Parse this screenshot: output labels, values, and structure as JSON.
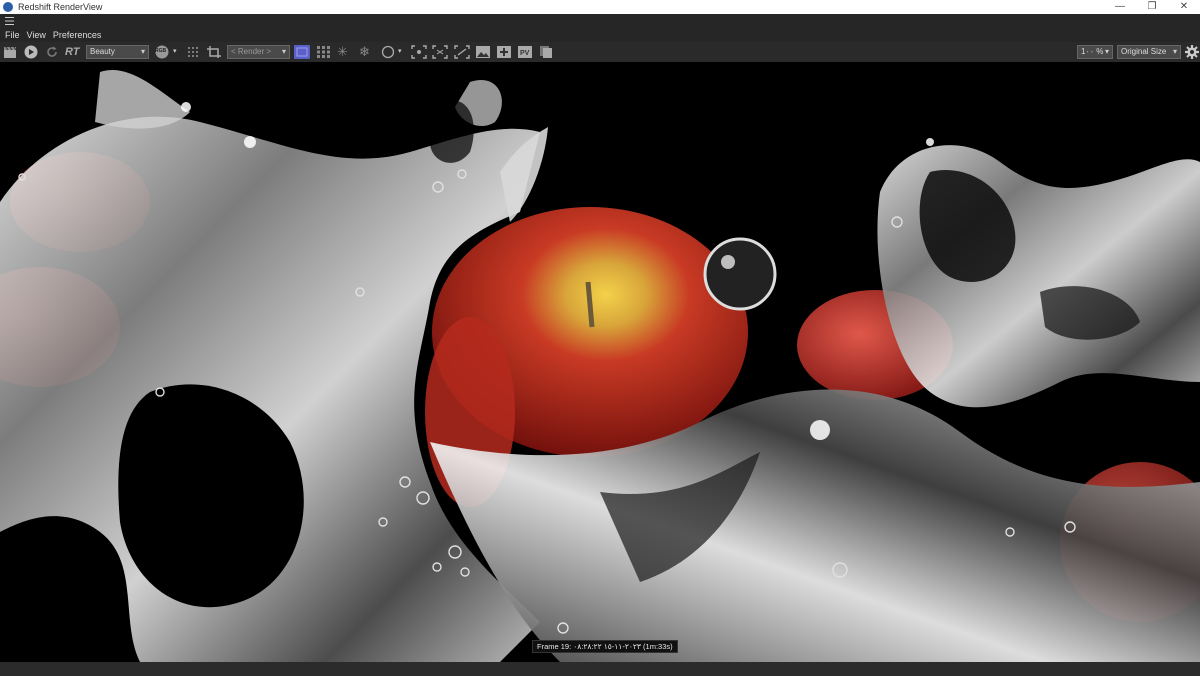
{
  "window": {
    "title": "Redshift RenderView"
  },
  "window_controls": {
    "minimize": "—",
    "restore": "❐",
    "close": "✕"
  },
  "menu": {
    "file": "File",
    "view": "View",
    "preferences": "Preferences"
  },
  "toolbar": {
    "rt_label": "RT",
    "aov_select": "Beauty",
    "rgb_label": "RGB",
    "camera_select": "< Render >",
    "zoom_value": "1٠٠ %",
    "size_select": "Original Size"
  },
  "render": {
    "frame_info": "Frame 19: ٢٠٢٣-١١-١٥ ٠٨:٢٨:٢٢ (1m:33s)"
  },
  "colors": {
    "accent": "#5b5fc7",
    "chrome": "#2a2a2a",
    "apple_red": "#b8201c"
  }
}
